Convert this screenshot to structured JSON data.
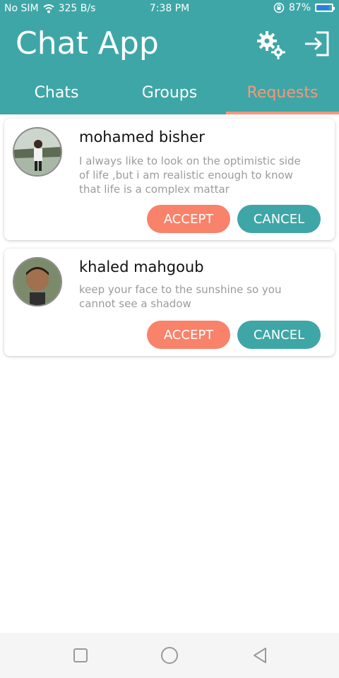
{
  "status_bar": {
    "carrier": "No SIM",
    "speed": "325 B/s",
    "time": "7:38 PM",
    "battery": "87%",
    "battery_level": 0.87
  },
  "app_bar": {
    "title": "Chat App",
    "icons": [
      "settings-icon",
      "logout-icon"
    ]
  },
  "tabs": [
    {
      "label": "Chats",
      "active": false
    },
    {
      "label": "Groups",
      "active": false
    },
    {
      "label": "Requests",
      "active": true
    }
  ],
  "requests": [
    {
      "name": "mohamed bisher",
      "message": "I always like to look on the optimistic side of life ,but i am realistic enough to know that life is a complex mattar",
      "accept_label": "ACCEPT",
      "cancel_label": "CANCEL"
    },
    {
      "name": "khaled mahgoub",
      "message": "keep your face to the sunshine so you cannot see  a shadow",
      "accept_label": "ACCEPT",
      "cancel_label": "CANCEL"
    }
  ],
  "colors": {
    "primary": "#3ea6a6",
    "accent": "#f9826a",
    "active_tab": "#f9967a"
  },
  "nav_bar": {
    "buttons": [
      "recent-apps-icon",
      "home-icon",
      "back-icon"
    ]
  }
}
